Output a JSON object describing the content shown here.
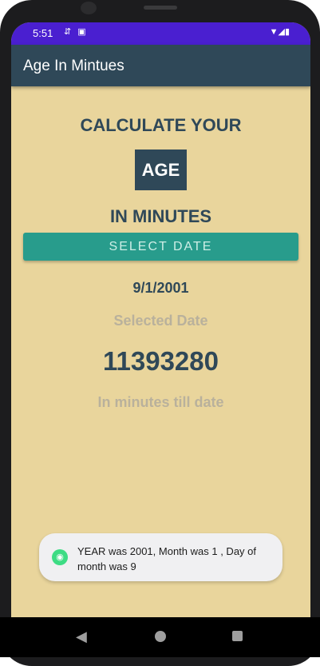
{
  "status_bar": {
    "time": "5:51",
    "left_icons": [
      "notification-icon",
      "usb-debug-icon"
    ],
    "right_icons": [
      "wifi-icon",
      "signal-icon",
      "battery-icon"
    ]
  },
  "app_bar": {
    "title": "Age In Mintues"
  },
  "content": {
    "heading_top": "CALCULATE YOUR",
    "heading_box": "AGE",
    "heading_bottom": "IN MINUTES",
    "select_button": "SELECT DATE",
    "selected_date_value": "9/1/2001",
    "selected_date_label": "Selected Date",
    "minutes_value": "11393280",
    "minutes_label": "In minutes till date"
  },
  "toast": {
    "icon": "android-icon",
    "message": "YEAR was 2001, Month was 1 , Day of month was 9"
  },
  "nav_bar": {
    "icons": [
      "back-icon",
      "home-icon",
      "recents-icon"
    ]
  },
  "colors": {
    "status_bar": "#4a1fd0",
    "app_bar": "#2f4858",
    "background": "#e9d59c",
    "button": "#289c8c",
    "muted_text": "#b9b19c"
  }
}
